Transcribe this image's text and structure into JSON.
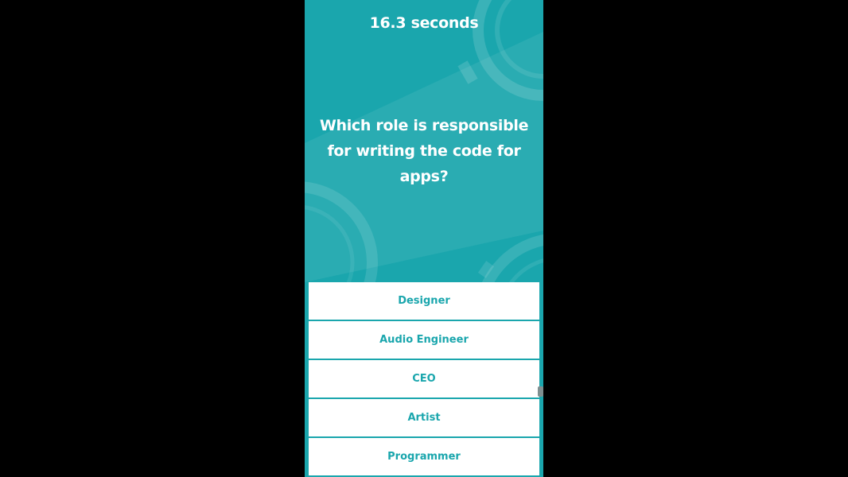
{
  "quiz": {
    "timer_text": "16.3 seconds",
    "question": "Which role is responsible for writing the code for apps?",
    "answers": [
      {
        "label": "Designer"
      },
      {
        "label": "Audio Engineer"
      },
      {
        "label": "CEO"
      },
      {
        "label": "Artist"
      },
      {
        "label": "Programmer"
      }
    ]
  },
  "colors": {
    "background": "#000000",
    "panel": "#1aa6ad",
    "answer_bg": "#ffffff",
    "answer_text": "#1aa6ad"
  }
}
